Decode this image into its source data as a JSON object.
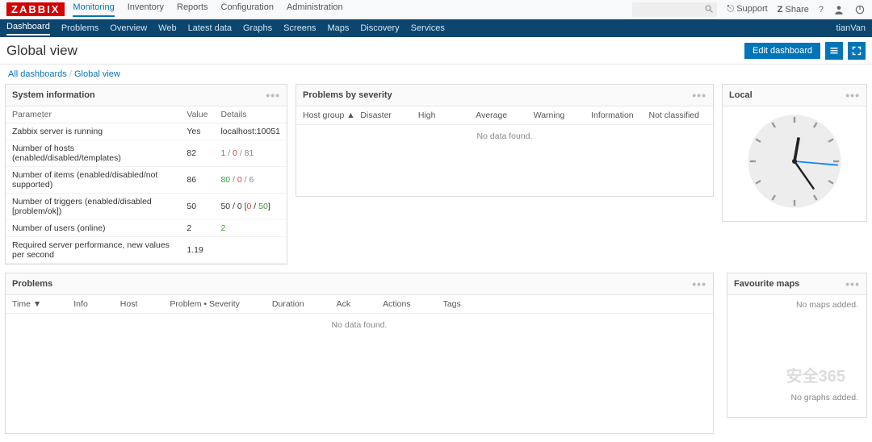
{
  "brand": "ZABBIX",
  "topnav": [
    "Monitoring",
    "Inventory",
    "Reports",
    "Configuration",
    "Administration"
  ],
  "topnav_active": 0,
  "header_right": {
    "support": "Support",
    "share": "Share"
  },
  "subnav": [
    "Dashboard",
    "Problems",
    "Overview",
    "Web",
    "Latest data",
    "Graphs",
    "Screens",
    "Maps",
    "Discovery",
    "Services"
  ],
  "subnav_active": 0,
  "subnav_user": "tianVan",
  "page_title": "Global view",
  "edit_dashboard": "Edit dashboard",
  "breadcrumb": {
    "root": "All dashboards",
    "current": "Global view"
  },
  "sysinfo": {
    "title": "System information",
    "cols": {
      "param": "Parameter",
      "value": "Value",
      "details": "Details"
    },
    "rows": [
      {
        "p": "Zabbix server is running",
        "v": "Yes",
        "d": "localhost:10051",
        "vc": "green"
      },
      {
        "p": "Number of hosts (enabled/disabled/templates)",
        "v": "82",
        "d": "1 / 0 / 81",
        "dc": "mix1"
      },
      {
        "p": "Number of items (enabled/disabled/not supported)",
        "v": "86",
        "d": "80 / 0 / 6",
        "dc": "mix2"
      },
      {
        "p": "Number of triggers (enabled/disabled [problem/ok])",
        "v": "50",
        "d": "50 / 0 [0 / 50]",
        "dc": "mix3"
      },
      {
        "p": "Number of users (online)",
        "v": "2",
        "d": "2",
        "dc": "green"
      },
      {
        "p": "Required server performance, new values per second",
        "v": "1.19",
        "d": ""
      }
    ]
  },
  "severity": {
    "title": "Problems by severity",
    "cols": [
      "Host group ▲",
      "Disaster",
      "High",
      "Average",
      "Warning",
      "Information",
      "Not classified"
    ],
    "nodata": "No data found."
  },
  "local": {
    "title": "Local"
  },
  "problems": {
    "title": "Problems",
    "cols": [
      "Time ▼",
      "Info",
      "Host",
      "Problem • Severity",
      "Duration",
      "Ack",
      "Actions",
      "Tags"
    ],
    "nodata": "No data found."
  },
  "favmaps": {
    "title": "Favourite maps",
    "empty": "No maps added."
  },
  "nographs": "No graphs added.",
  "watermark": "安全365"
}
